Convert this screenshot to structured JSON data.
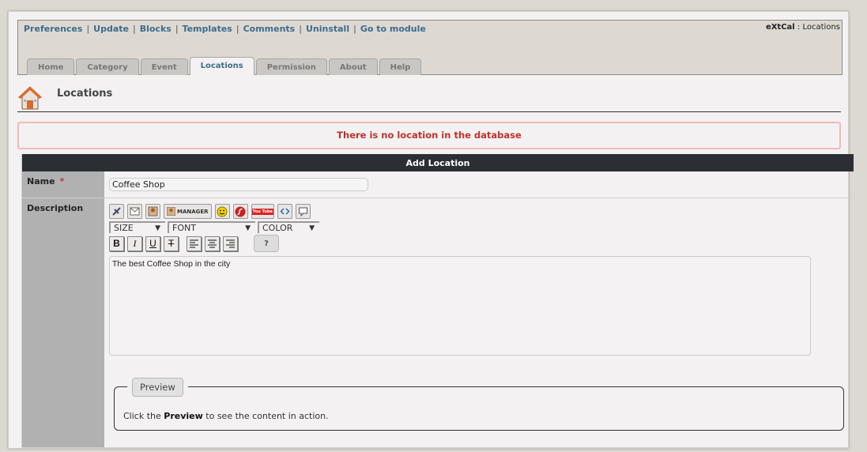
{
  "top_links": [
    "Preferences",
    "Update",
    "Blocks",
    "Templates",
    "Comments",
    "Uninstall",
    "Go to module"
  ],
  "module": {
    "name": "eXtCal",
    "separator": ":",
    "current": "Locations"
  },
  "tabs": [
    {
      "label": "Home"
    },
    {
      "label": "Category"
    },
    {
      "label": "Event"
    },
    {
      "label": "Locations",
      "active": true
    },
    {
      "label": "Permission"
    },
    {
      "label": "About"
    },
    {
      "label": "Help"
    }
  ],
  "page": {
    "title": "Locations",
    "icon": "house-icon"
  },
  "error_message": "There is no location in the database",
  "form": {
    "caption": "Add Location",
    "name_label": "Name",
    "required_marker": "*",
    "name_value": "Coffee Shop",
    "description_label": "Description",
    "toolbar_icons": [
      "url-icon",
      "email-icon",
      "image-icon",
      "image-manager-button",
      "smilies-icon",
      "flash-icon",
      "youtube-icon",
      "code-icon",
      "quote-icon"
    ],
    "manager_label": "MANAGER",
    "youtube_label": "You Tube",
    "size_select": "SIZE",
    "font_select": "FONT",
    "color_select": "COLOR",
    "format_buttons": {
      "bold": "B",
      "italic": "I",
      "underline": "U",
      "strike": "T"
    },
    "help_label": "?",
    "description_value": "The best Coffee Shop in the city",
    "preview_button": "Preview",
    "preview_hint_prefix": "Click the",
    "preview_hint_bold": "Preview",
    "preview_hint_suffix": "to see the content in action."
  },
  "colors": {
    "accent_link": "#3e6b8c",
    "error": "#c0322b",
    "caption_bg": "#2b2f34"
  }
}
